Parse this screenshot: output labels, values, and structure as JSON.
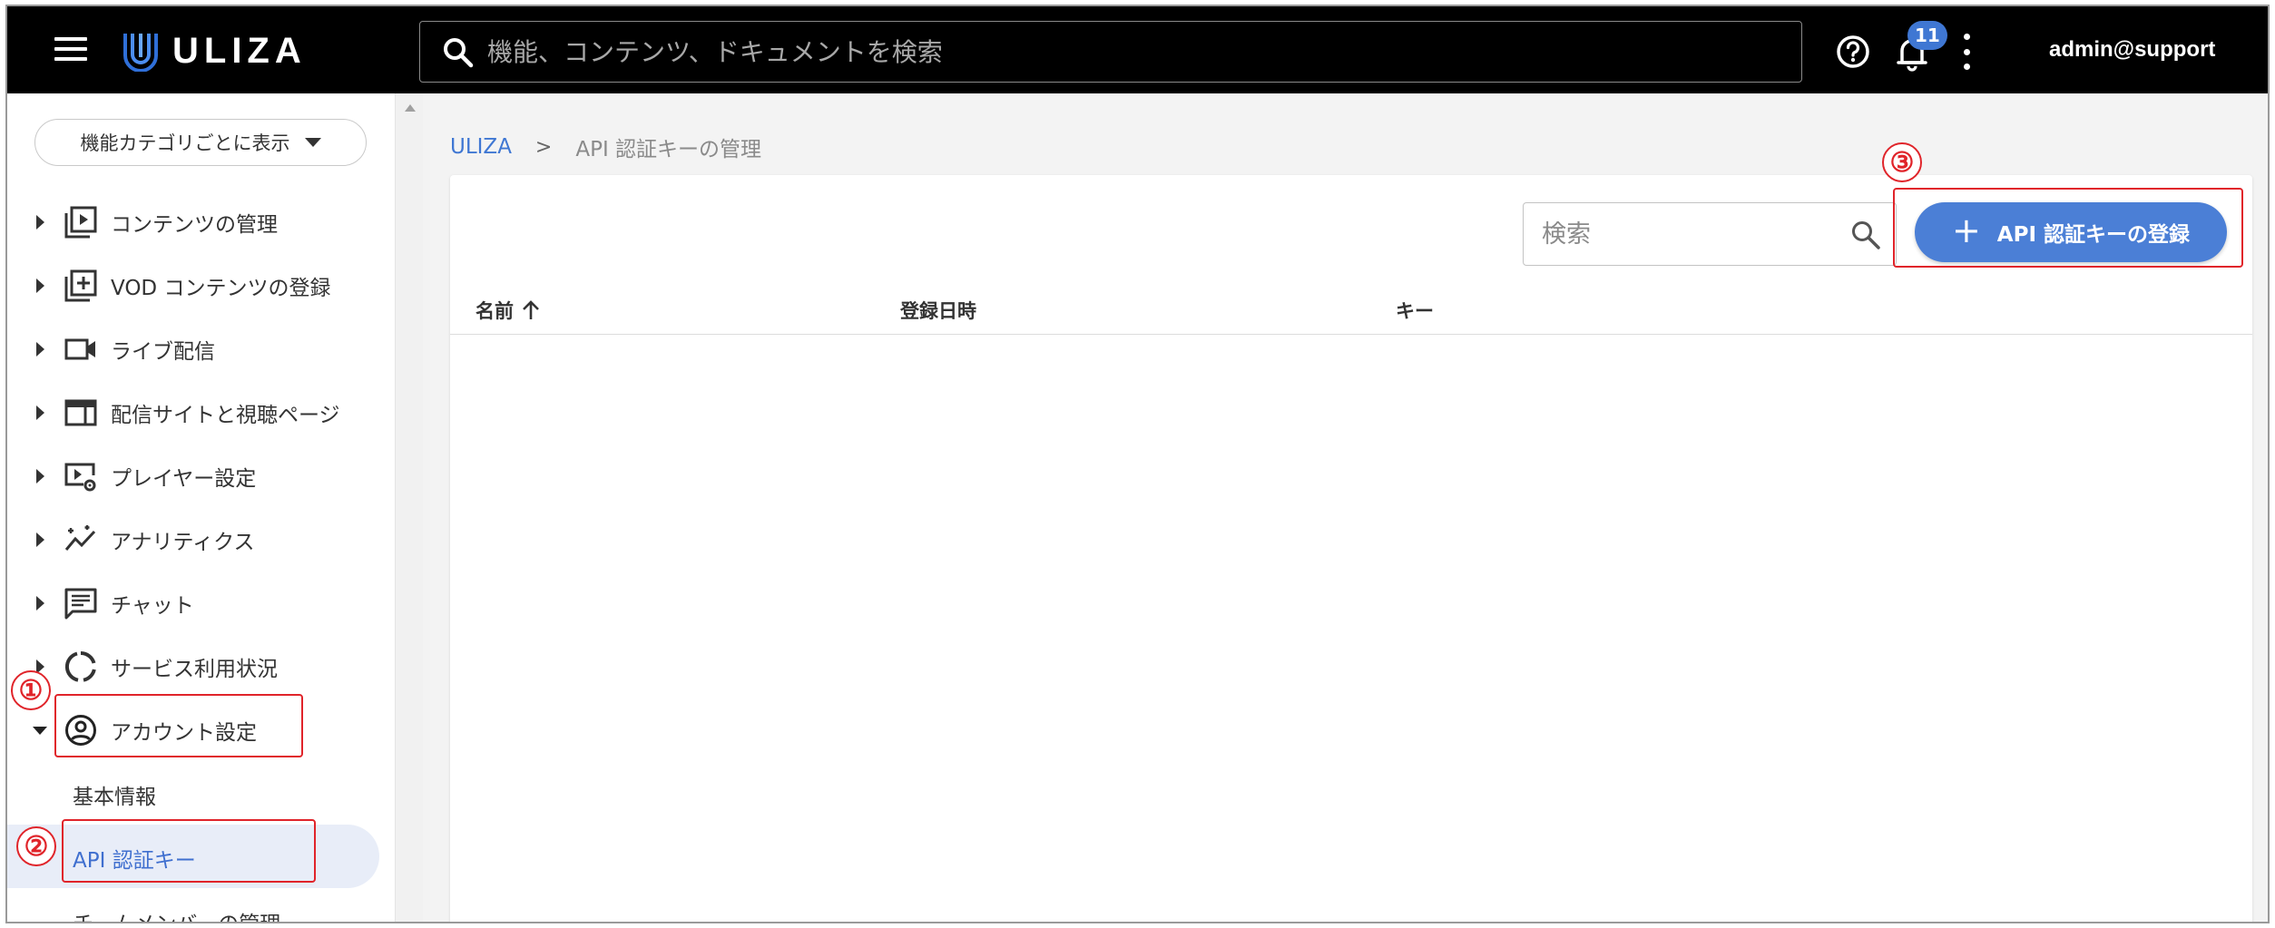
{
  "header": {
    "logo_text": "ULIZA",
    "search_placeholder": "機能、コンテンツ、ドキュメントを検索",
    "notification_count": "11",
    "user": "admin@support"
  },
  "sidebar": {
    "category_button": "機能カテゴリごとに表示",
    "items": [
      {
        "label": "コンテンツの管理",
        "icon": "video-library-icon"
      },
      {
        "label": "VOD コンテンツの登録",
        "icon": "add-box-icon"
      },
      {
        "label": "ライブ配信",
        "icon": "video-camera-icon"
      },
      {
        "label": "配信サイトと視聴ページ",
        "icon": "web-layout-icon"
      },
      {
        "label": "プレイヤー設定",
        "icon": "player-settings-icon"
      },
      {
        "label": "アナリティクス",
        "icon": "analytics-icon"
      },
      {
        "label": "チャット",
        "icon": "chat-icon"
      },
      {
        "label": "サービス利用状況",
        "icon": "donut-chart-icon"
      },
      {
        "label": "アカウント設定",
        "icon": "account-circle-icon"
      }
    ],
    "sub_items": [
      {
        "label": "基本情報"
      },
      {
        "label": "API 認証キー"
      },
      {
        "label": "チームメンバーの管理"
      }
    ]
  },
  "breadcrumb": {
    "root": "ULIZA",
    "separator": ">",
    "current": "API 認証キーの管理"
  },
  "toolbar": {
    "search_placeholder": "検索",
    "add_button": "API 認証キーの登録"
  },
  "table": {
    "columns": [
      "名前",
      "登録日時",
      "キー"
    ]
  },
  "annotations": [
    "①",
    "②",
    "③"
  ],
  "colors": {
    "accent": "#4b7fd6",
    "header_bg": "#000000",
    "annotation": "#e0242a"
  }
}
